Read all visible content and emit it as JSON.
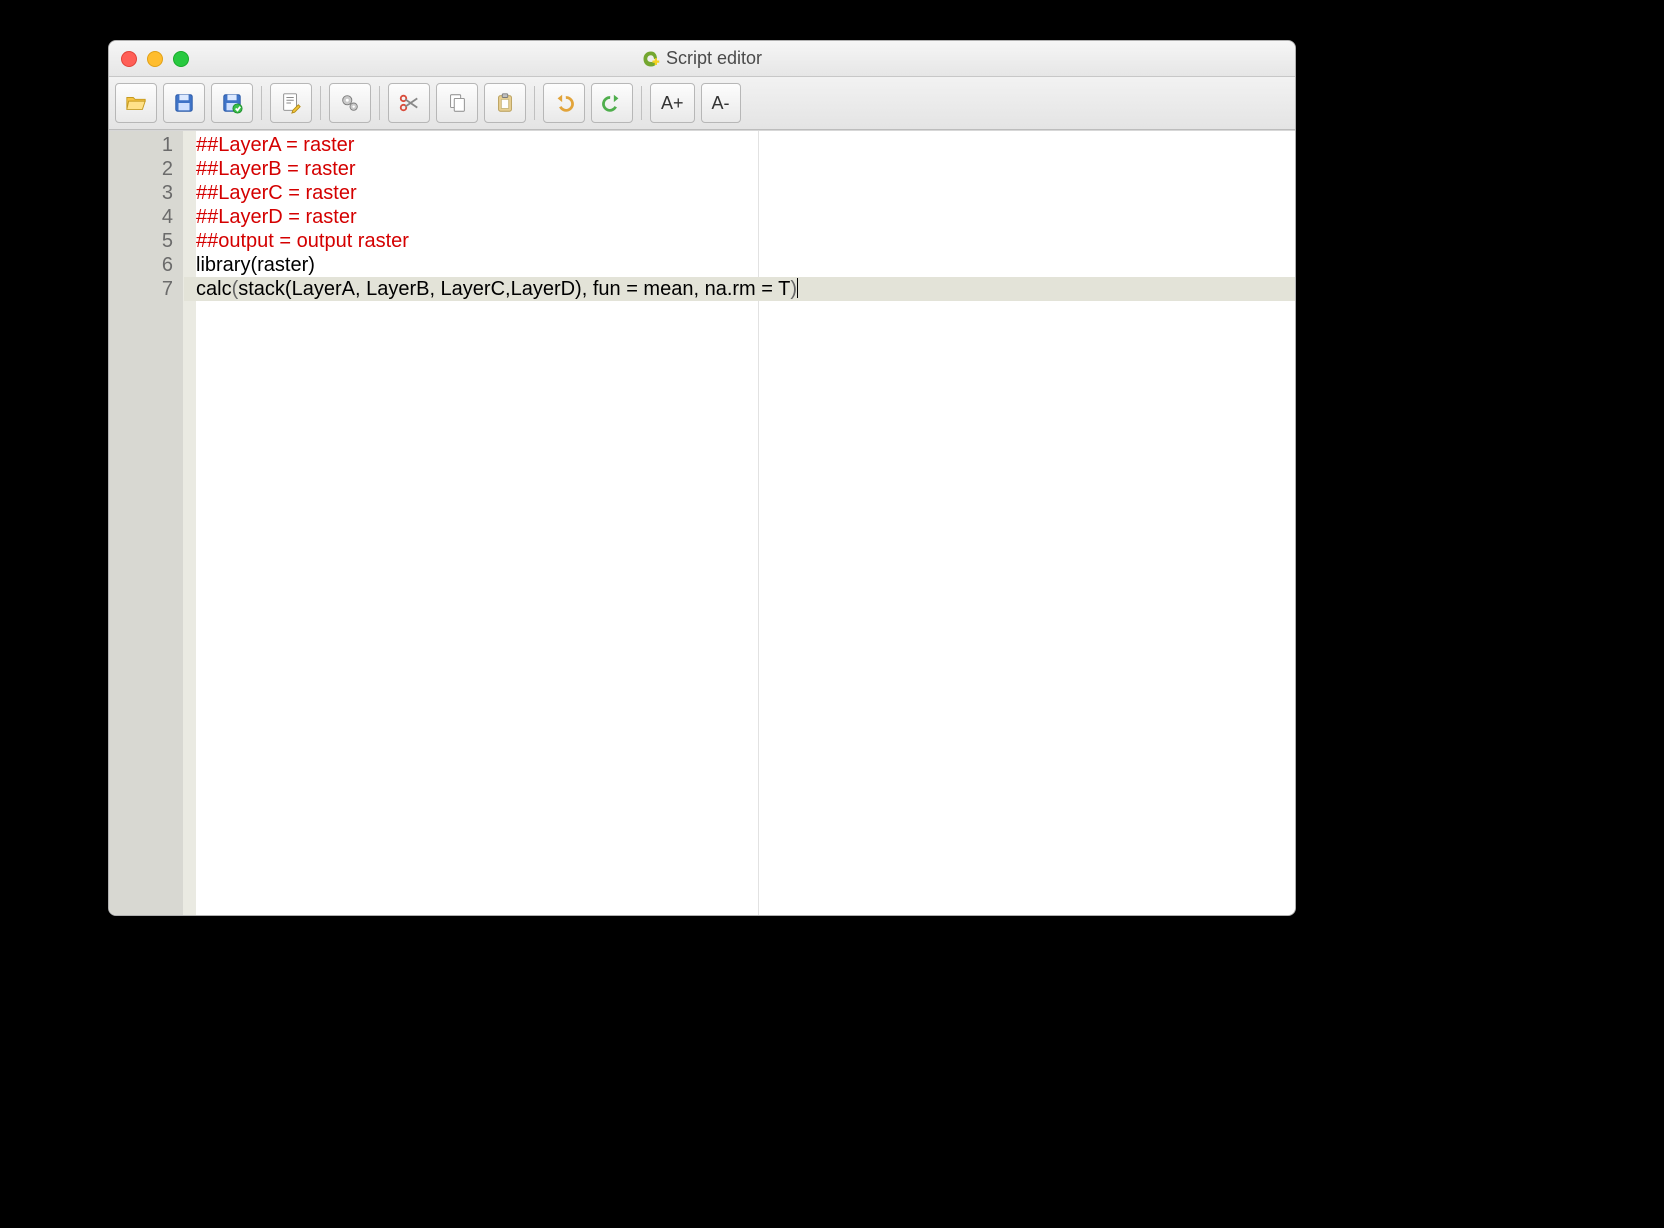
{
  "window": {
    "title": "Script editor"
  },
  "toolbar": {
    "open": "Open",
    "save": "Save",
    "saveas": "Save As",
    "editmeta": "Edit metadata",
    "run": "Run",
    "cut": "Cut",
    "copy": "Copy",
    "paste": "Paste",
    "undo": "Undo",
    "redo": "Redo",
    "zoomin_label": "A+",
    "zoomout_label": "A-"
  },
  "editor": {
    "current_line_index": 6,
    "lines": [
      {
        "n": 1,
        "segments": [
          {
            "text": "##LayerA = raster",
            "cls": "red"
          }
        ]
      },
      {
        "n": 2,
        "segments": [
          {
            "text": "##LayerB = raster",
            "cls": "red"
          }
        ]
      },
      {
        "n": 3,
        "segments": [
          {
            "text": "##LayerC = raster",
            "cls": "red"
          }
        ]
      },
      {
        "n": 4,
        "segments": [
          {
            "text": "##LayerD = raster",
            "cls": "red"
          }
        ]
      },
      {
        "n": 5,
        "segments": [
          {
            "text": "##output = output raster",
            "cls": "red"
          }
        ]
      },
      {
        "n": 6,
        "segments": [
          {
            "text": "library(raster)",
            "cls": "blk"
          }
        ]
      },
      {
        "n": 7,
        "segments": [
          {
            "text": "calc",
            "cls": "blk"
          },
          {
            "text": "(",
            "cls": "paren"
          },
          {
            "text": "stack(LayerA, LayerB, LayerC,LayerD), fun = mean, na.rm = T",
            "cls": "blk"
          },
          {
            "text": ")",
            "cls": "paren"
          }
        ]
      }
    ]
  }
}
